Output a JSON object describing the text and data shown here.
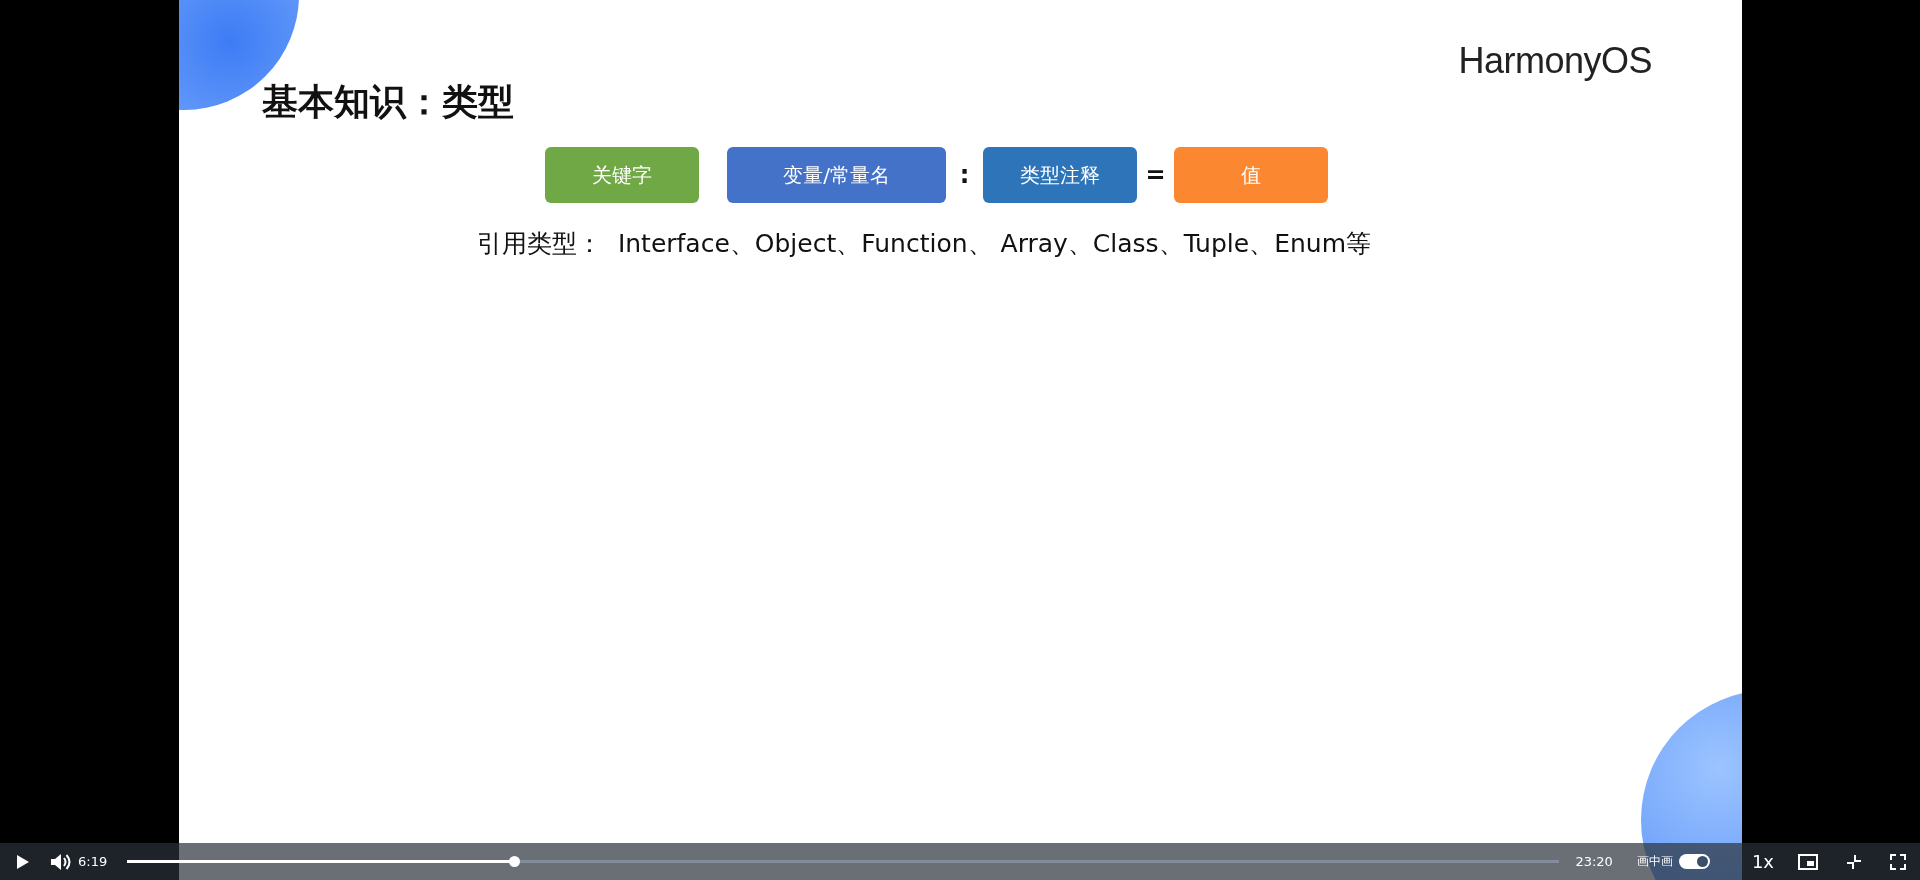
{
  "slide": {
    "logo": "HarmonyOS",
    "title": "基本知识：类型",
    "syntax": [
      {
        "kind": "box",
        "text": "关键字",
        "color": "#70a845"
      },
      {
        "kind": "box",
        "text": "变量/常量名",
        "color": "#4472c8"
      },
      {
        "kind": "sep",
        "text": ":"
      },
      {
        "kind": "box",
        "text": "类型注释",
        "color": "#2e74b8"
      },
      {
        "kind": "sep",
        "text": "="
      },
      {
        "kind": "box",
        "text": "值",
        "color": "#fb8731"
      }
    ],
    "note": "引用类型：  Interface、Object、Function、 Array、Class、Tuple、Enum等"
  },
  "controls": {
    "playing": false,
    "elapsed": "6:19",
    "progress": {
      "level": 0.27
    },
    "duration": "23:20",
    "pip_label": "画中画",
    "pip_toggle": {
      "on": true
    },
    "speed": "1x"
  }
}
